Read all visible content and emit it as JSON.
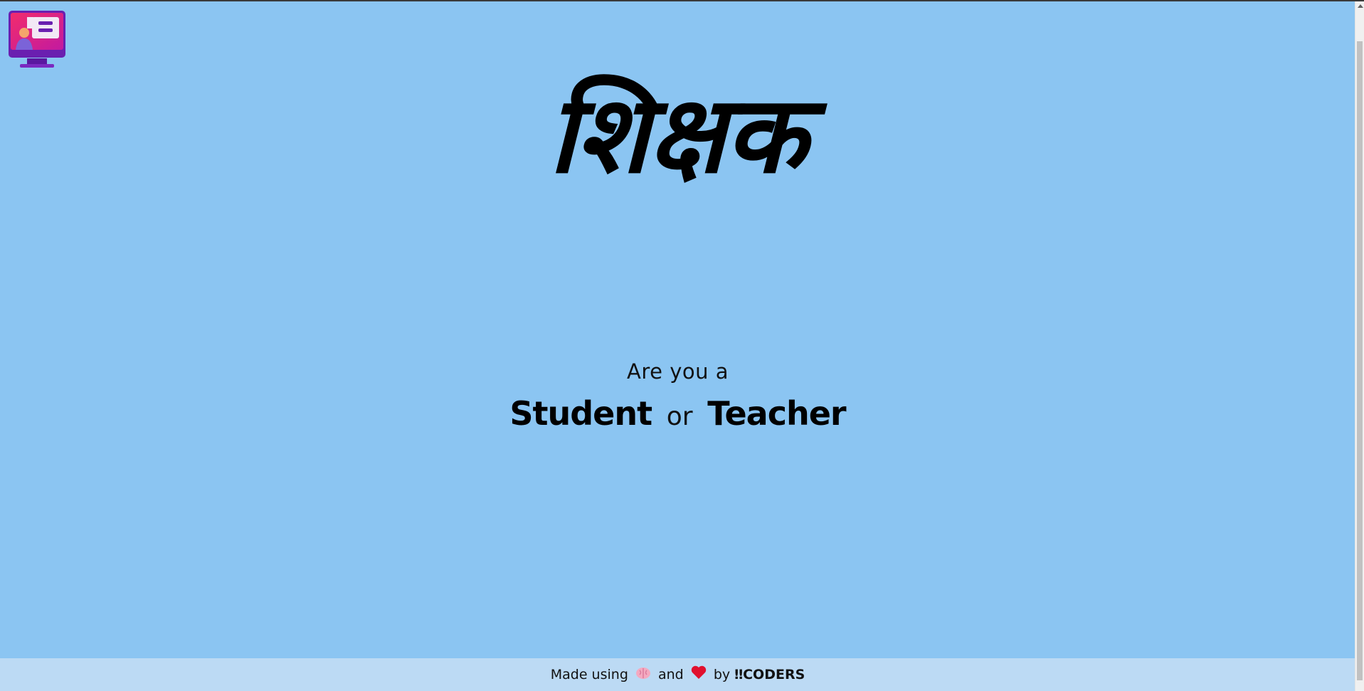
{
  "brand": {
    "title": "शिक्षक",
    "logo_icon": "classroom-monitor-icon"
  },
  "prompt": {
    "question": "Are you a",
    "student_label": "Student",
    "or_label": "or",
    "teacher_label": "Teacher"
  },
  "footer": {
    "made_using": "Made using",
    "brain_icon": "brain-icon",
    "and": "and",
    "heart_icon": "heart-icon",
    "by": "by",
    "team": "‼CODERS"
  },
  "colors": {
    "background": "#8bc5f2",
    "footer_background": "#bcdaf4",
    "logo_pink": "#f0266e",
    "logo_purple": "#6a1fb0"
  }
}
